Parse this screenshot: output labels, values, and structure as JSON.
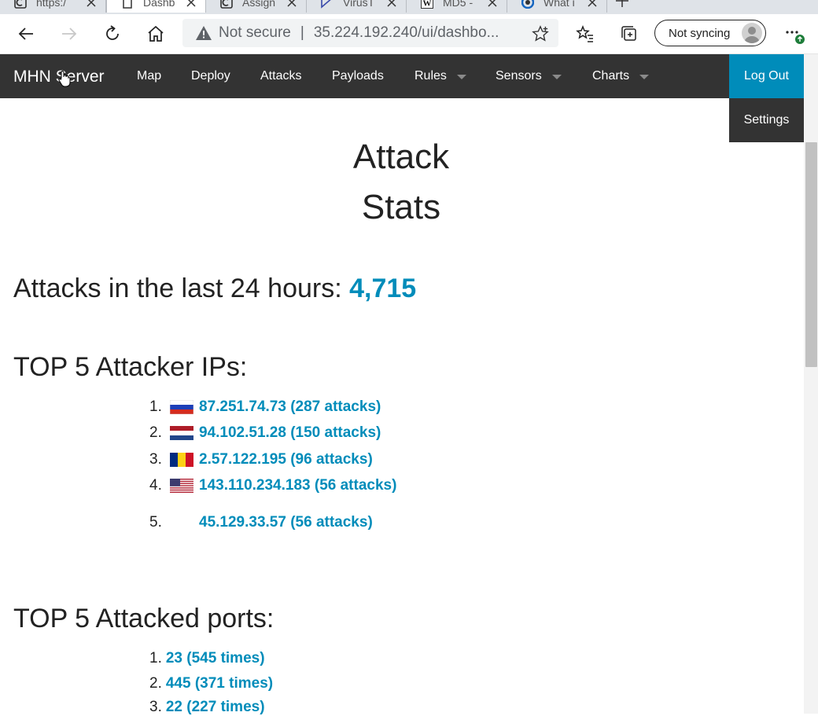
{
  "browser": {
    "tabs": [
      {
        "label": "https:/",
        "icon": "page-favicon",
        "active": false
      },
      {
        "label": "Dashb",
        "icon": "document-favicon",
        "active": true
      },
      {
        "label": "Assign",
        "icon": "page-favicon",
        "active": false
      },
      {
        "label": "VirusT",
        "icon": "virustotal-favicon",
        "active": false
      },
      {
        "label": "MD5 -",
        "icon": "wikipedia-favicon",
        "active": false
      },
      {
        "label": "What i",
        "icon": "site-favicon",
        "active": false
      }
    ],
    "address": {
      "security_label": "Not secure",
      "separator": "|",
      "url": "35.224.192.240/ui/dashbo..."
    },
    "sync_label": "Not syncing"
  },
  "site": {
    "brand": "MHN Server",
    "nav": [
      {
        "label": "Map",
        "dropdown": false
      },
      {
        "label": "Deploy",
        "dropdown": false
      },
      {
        "label": "Attacks",
        "dropdown": false
      },
      {
        "label": "Payloads",
        "dropdown": false
      },
      {
        "label": "Rules",
        "dropdown": true
      },
      {
        "label": "Sensors",
        "dropdown": true
      },
      {
        "label": "Charts",
        "dropdown": true
      }
    ],
    "logout": "Log Out",
    "settings": "Settings",
    "accent_color": "#008cba",
    "nav_color": "#333333"
  },
  "page": {
    "title_line1": "Attack",
    "title_line2": "Stats",
    "attacks_label": "Attacks in the last 24 hours: ",
    "attacks_count": "4,715",
    "top_ips_heading": "TOP 5 Attacker IPs:",
    "top_ips": [
      {
        "rank": "1.",
        "flag": "russia",
        "text": "87.251.74.73 (287 attacks)"
      },
      {
        "rank": "2.",
        "flag": "netherlands",
        "text": "94.102.51.28 (150 attacks)"
      },
      {
        "rank": "3.",
        "flag": "romania",
        "text": "2.57.122.195 (96 attacks)"
      },
      {
        "rank": "4.",
        "flag": "united-states",
        "text": "143.110.234.183 (56 attacks)"
      },
      {
        "rank": "5.",
        "flag": "none",
        "text": "45.129.33.57 (56 attacks)"
      }
    ],
    "top_ports_heading": "TOP 5 Attacked ports:",
    "top_ports": [
      {
        "rank": "1.",
        "text": "23 (545 times)"
      },
      {
        "rank": "2.",
        "text": "445 (371 times)"
      },
      {
        "rank": "3.",
        "text": "22 (227 times)"
      }
    ]
  }
}
